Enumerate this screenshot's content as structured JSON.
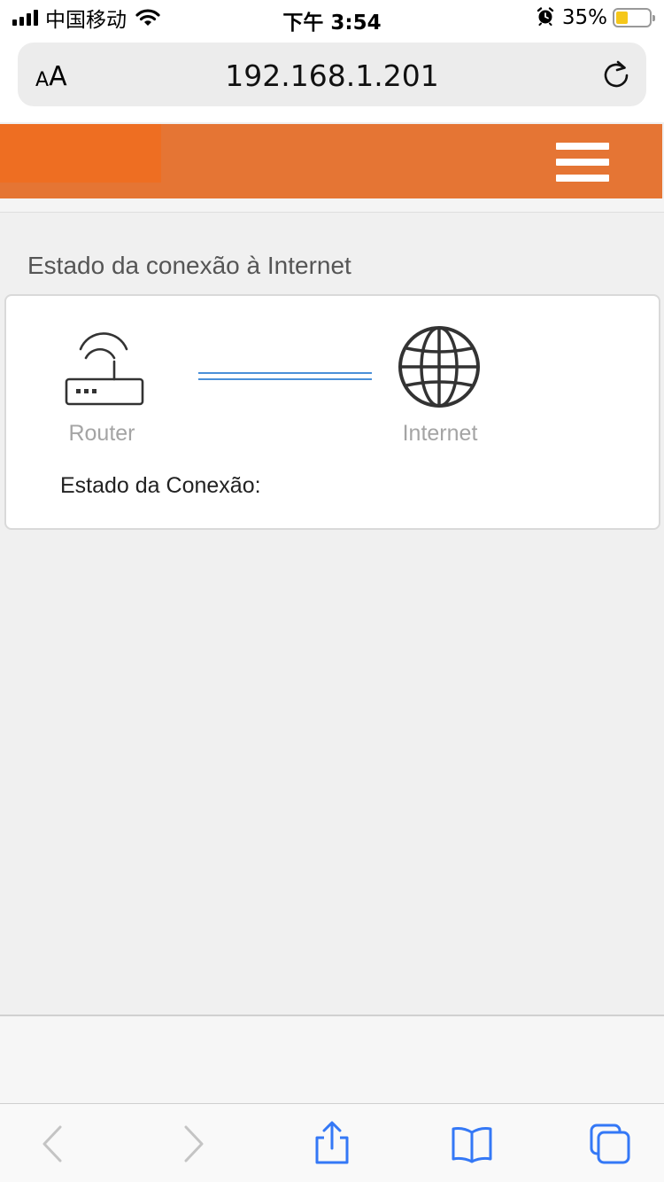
{
  "status_bar": {
    "carrier": "中国移动",
    "time": "下午 3:54",
    "battery_percent": "35%",
    "battery_level": 0.35,
    "icons": [
      "cellular-signal-icon",
      "wifi-icon",
      "alarm-icon",
      "battery-icon"
    ]
  },
  "browser": {
    "text_size_small": "A",
    "text_size_big": "A",
    "url": "192.168.1.201"
  },
  "header": {
    "accent_color": "#e57534",
    "logo_color": "#ee6e22"
  },
  "main": {
    "section_title": "Estado da conexão à Internet",
    "router_label": "Router",
    "internet_label": "Internet",
    "connection_status_label": "Estado da Conexão:"
  },
  "colors": {
    "link_line": "#4a90d9",
    "toolbar_icon": "#3478f6",
    "toolbar_icon_disabled": "#c4c4c4"
  }
}
